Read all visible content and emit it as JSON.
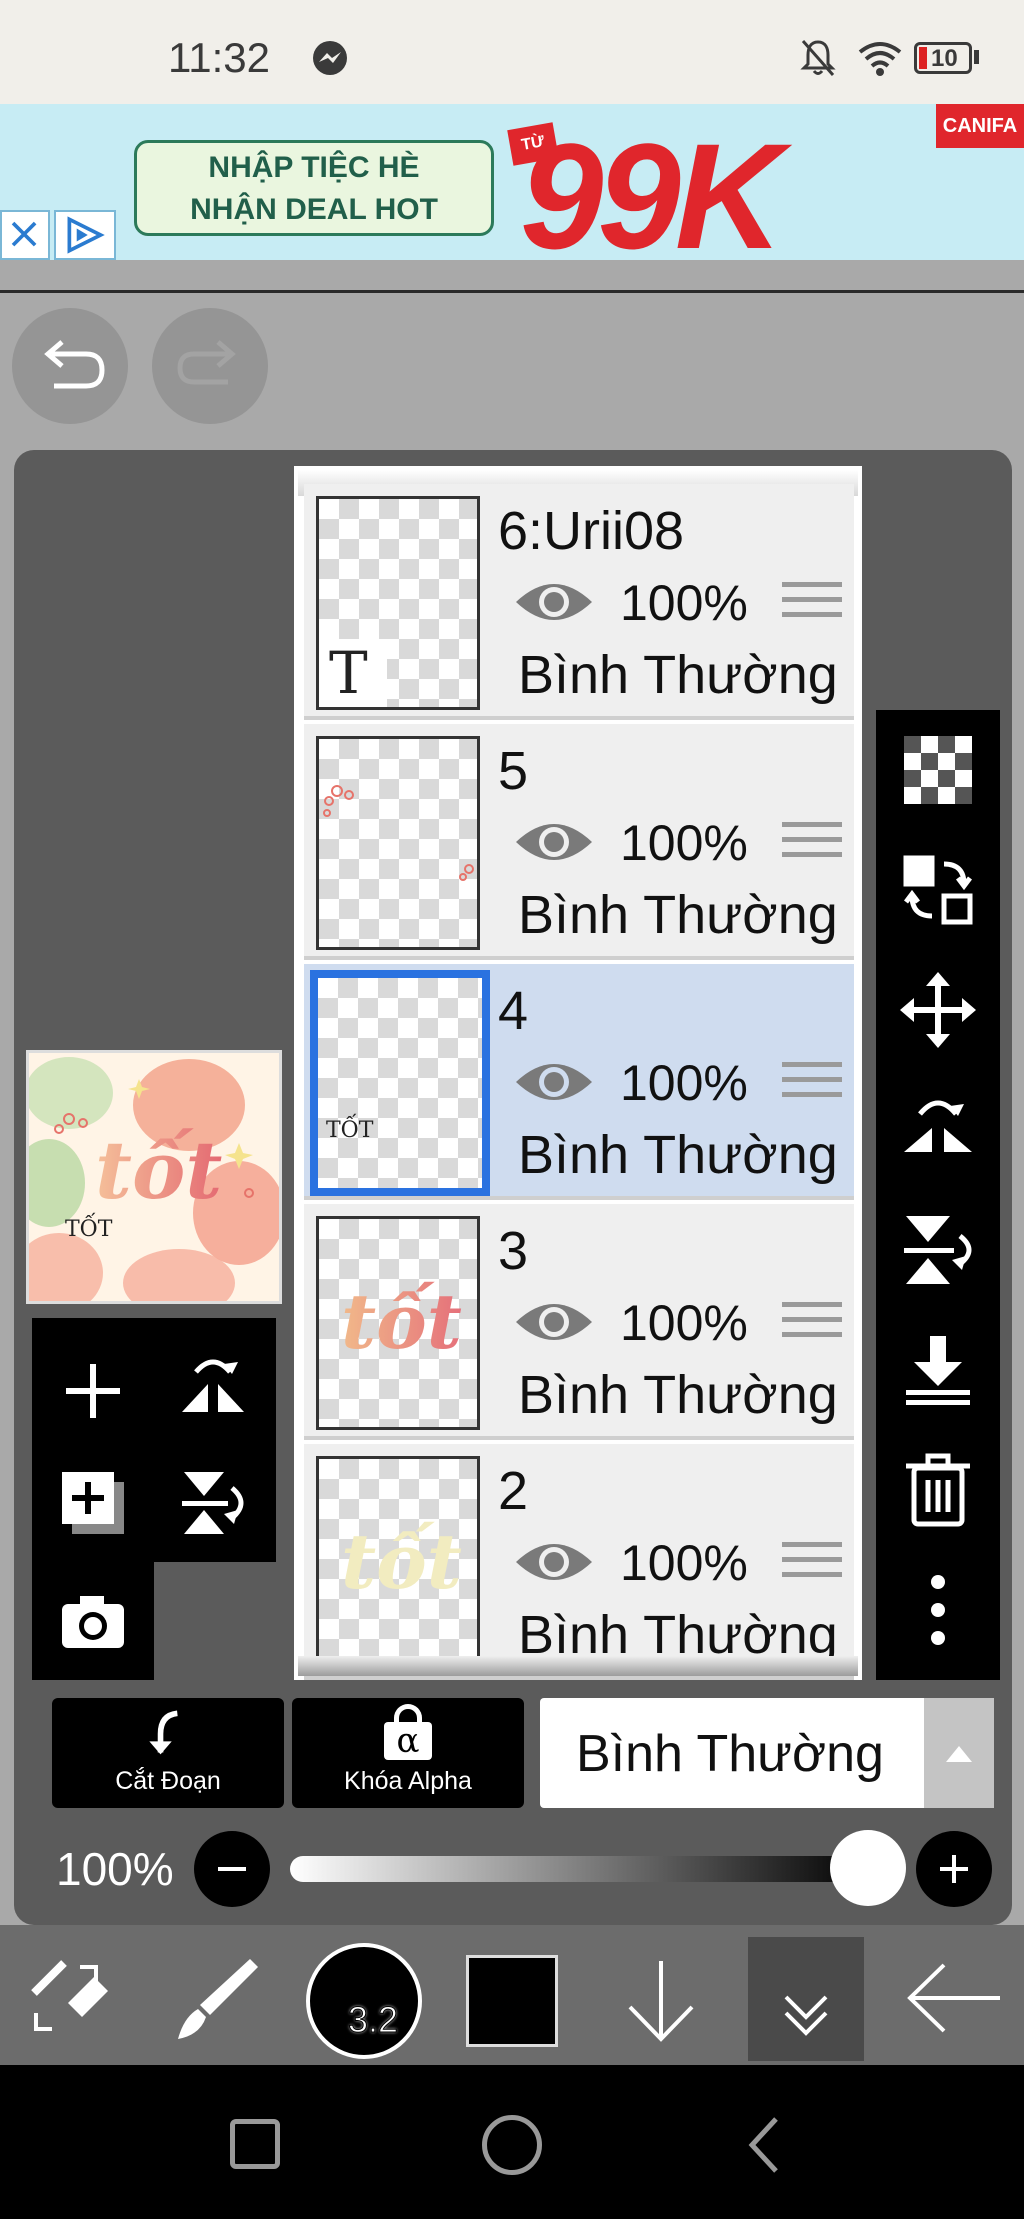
{
  "status_bar": {
    "time": "11:32",
    "icons": [
      "messenger-icon",
      "bell-off-icon",
      "wifi-icon",
      "battery-icon"
    ],
    "battery": "10"
  },
  "ad": {
    "line1": "NHẬP TIỆC HÈ",
    "line2": "NHẬN DEAL HOT",
    "badge": "TỪ",
    "price": "99K",
    "brand": "CANIFA",
    "close_icon": "close-icon",
    "adchoices_icon": "adchoices-icon",
    "colors": {
      "bg": "#c7ecf4",
      "red": "#e0262c",
      "green": "#215f4a"
    }
  },
  "toolbar": {
    "undo_icon": "undo-icon",
    "redo_icon": "redo-icon"
  },
  "layers": [
    {
      "name": "6:Urii08",
      "opacity": "100%",
      "blend": "Bình Thường",
      "visible": true,
      "selected": false,
      "thumb": "text-layer"
    },
    {
      "name": "5",
      "opacity": "100%",
      "blend": "Bình Thường",
      "visible": true,
      "selected": false,
      "thumb": "dots"
    },
    {
      "name": "4",
      "opacity": "100%",
      "blend": "Bình Thường",
      "visible": true,
      "selected": true,
      "thumb": "small-text"
    },
    {
      "name": "3",
      "opacity": "100%",
      "blend": "Bình Thường",
      "visible": true,
      "selected": false,
      "thumb": "tot-gradient"
    },
    {
      "name": "2",
      "opacity": "100%",
      "blend": "Bình Thường",
      "visible": true,
      "selected": false,
      "thumb": "tot-pale"
    }
  ],
  "thumb_text": {
    "t_glyph": "T",
    "tot": "tốt",
    "small": "TỐT"
  },
  "right_toolbar": [
    "transparency-icon",
    "layer-transform-icon",
    "move-icon",
    "flip-horizontal-icon",
    "flip-vertical-rotate-icon",
    "merge-down-icon",
    "trash-icon",
    "more-icon"
  ],
  "left_tools": [
    "add-layer-icon",
    "flip-rotate-icon",
    "add-copy-layer-icon",
    "flip-vertical-icon",
    "camera-icon"
  ],
  "canvas_preview": {
    "title_text": "tốt",
    "small_text": "TỐT"
  },
  "bottom_buttons": {
    "clip": {
      "label": "Cắt Đoạn",
      "icon": "clip-arrow-icon"
    },
    "alpha_lock": {
      "label": "Khóa Alpha",
      "icon": "alpha-lock-icon",
      "glyph": "α"
    },
    "blend_mode": "Bình Thường"
  },
  "opacity": {
    "label": "100%",
    "value": 1.0
  },
  "brush": {
    "size": "3.2",
    "color": "#000000"
  },
  "bottom_tools": [
    "transform-tool-icon",
    "brush-icon",
    "brush-size-icon",
    "color-swatch",
    "arrow-down-icon",
    "layers-collapse-icon",
    "back-arrow-icon"
  ],
  "nav_bar": [
    "recent-apps-icon",
    "home-icon",
    "back-icon"
  ]
}
